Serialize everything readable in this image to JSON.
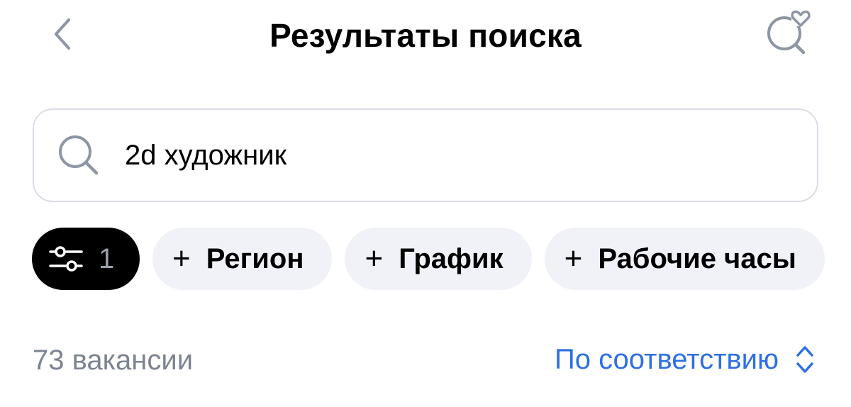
{
  "header": {
    "title": "Результаты поиска",
    "back_icon": "chevron-left-icon",
    "favorite_search_icon": "search-heart-icon"
  },
  "search": {
    "value": "2d художник",
    "icon": "search-icon"
  },
  "filters": {
    "filter_icon": "sliders-icon",
    "active_count": "1",
    "chips": [
      {
        "plus": "+",
        "label": "Регион"
      },
      {
        "plus": "+",
        "label": "График"
      },
      {
        "plus": "+",
        "label": "Рабочие часы"
      }
    ]
  },
  "results": {
    "count_label": "73 вакансии",
    "sort_label": "По соответствию",
    "sort_icon": "chevron-up-down-icon"
  },
  "colors": {
    "accent": "#2f6fe4",
    "muted_text": "#7c8391",
    "chip_bg": "#f0f2f7",
    "border": "#d9dde6",
    "icon_gray": "#8e95a3"
  }
}
